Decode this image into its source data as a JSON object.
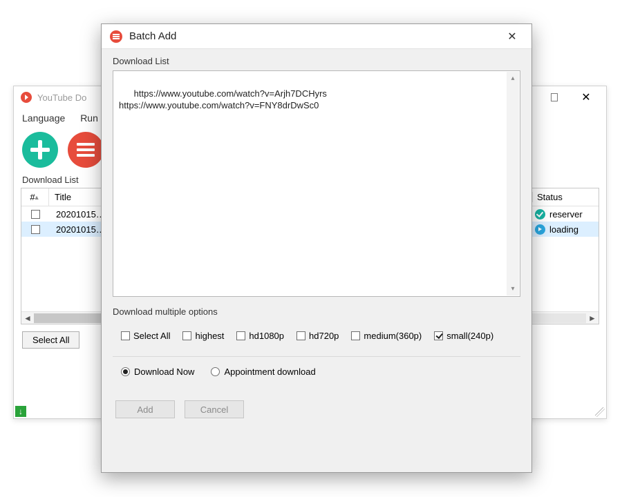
{
  "main": {
    "title": "YouTube Do",
    "menu": {
      "language": "Language",
      "run": "Run"
    },
    "section_label": "Download List",
    "columns": {
      "num": "#",
      "title": "Title",
      "status": "Status"
    },
    "rows": [
      {
        "title": "20201015…",
        "status": "reserver",
        "status_kind": "reserver",
        "selected": false
      },
      {
        "title": "20201015…",
        "status": "loading",
        "status_kind": "loading",
        "selected": true
      }
    ],
    "select_all": "Select All"
  },
  "dialog": {
    "title": "Batch Add",
    "list_label": "Download List",
    "textarea": "https://www.youtube.com/watch?v=Arjh7DCHyrs\nhttps://www.youtube.com/watch?v=FNY8drDwSc0",
    "options_label": "Download multiple options",
    "checks": [
      {
        "label": "Select All",
        "checked": false
      },
      {
        "label": "highest",
        "checked": false
      },
      {
        "label": "hd1080p",
        "checked": false
      },
      {
        "label": "hd720p",
        "checked": false
      },
      {
        "label": "medium(360p)",
        "checked": false
      },
      {
        "label": "small(240p)",
        "checked": true
      }
    ],
    "radios": [
      {
        "label": "Download Now",
        "selected": true
      },
      {
        "label": "Appointment download",
        "selected": false
      }
    ],
    "buttons": {
      "add": "Add",
      "cancel": "Cancel"
    }
  }
}
